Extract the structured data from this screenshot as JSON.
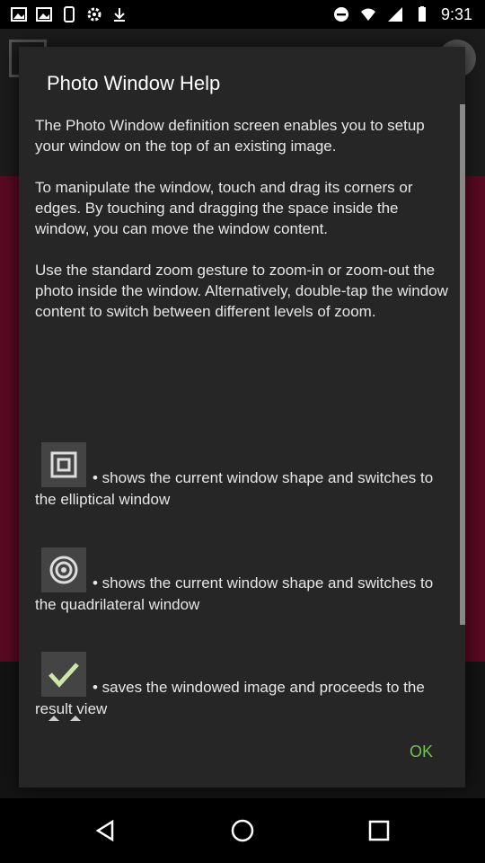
{
  "status_bar": {
    "time": "9:31",
    "icons": [
      "image-icon",
      "image-icon",
      "phone-icon",
      "gear-icon",
      "download-icon",
      "dnd-icon",
      "wifi-icon",
      "signal-icon",
      "battery-icon"
    ]
  },
  "dialog": {
    "title": "Photo Window Help",
    "paragraphs": [
      "The Photo Window definition screen enables you to setup your window on the top of an existing image.",
      "To manipulate the window, touch and drag its corners or edges. By touching and dragging the space inside the window, you can move the window content.",
      "Use the standard zoom gesture to zoom-in or zoom-out the photo inside the window. Alternatively, double-tap the window content to switch between different levels of zoom."
    ],
    "items": [
      {
        "icon": "square-window-icon",
        "text": "• shows the current window shape and switches to the elliptical window"
      },
      {
        "icon": "circle-window-icon",
        "text": "• shows the current window shape and switches to the quadrilateral window"
      },
      {
        "icon": "checkmark-icon",
        "text": "• saves the windowed image and proceeds to the result view"
      }
    ],
    "ok_label": "OK"
  },
  "nav_bar": {
    "icons": [
      "back-icon",
      "home-icon",
      "recents-icon"
    ]
  }
}
